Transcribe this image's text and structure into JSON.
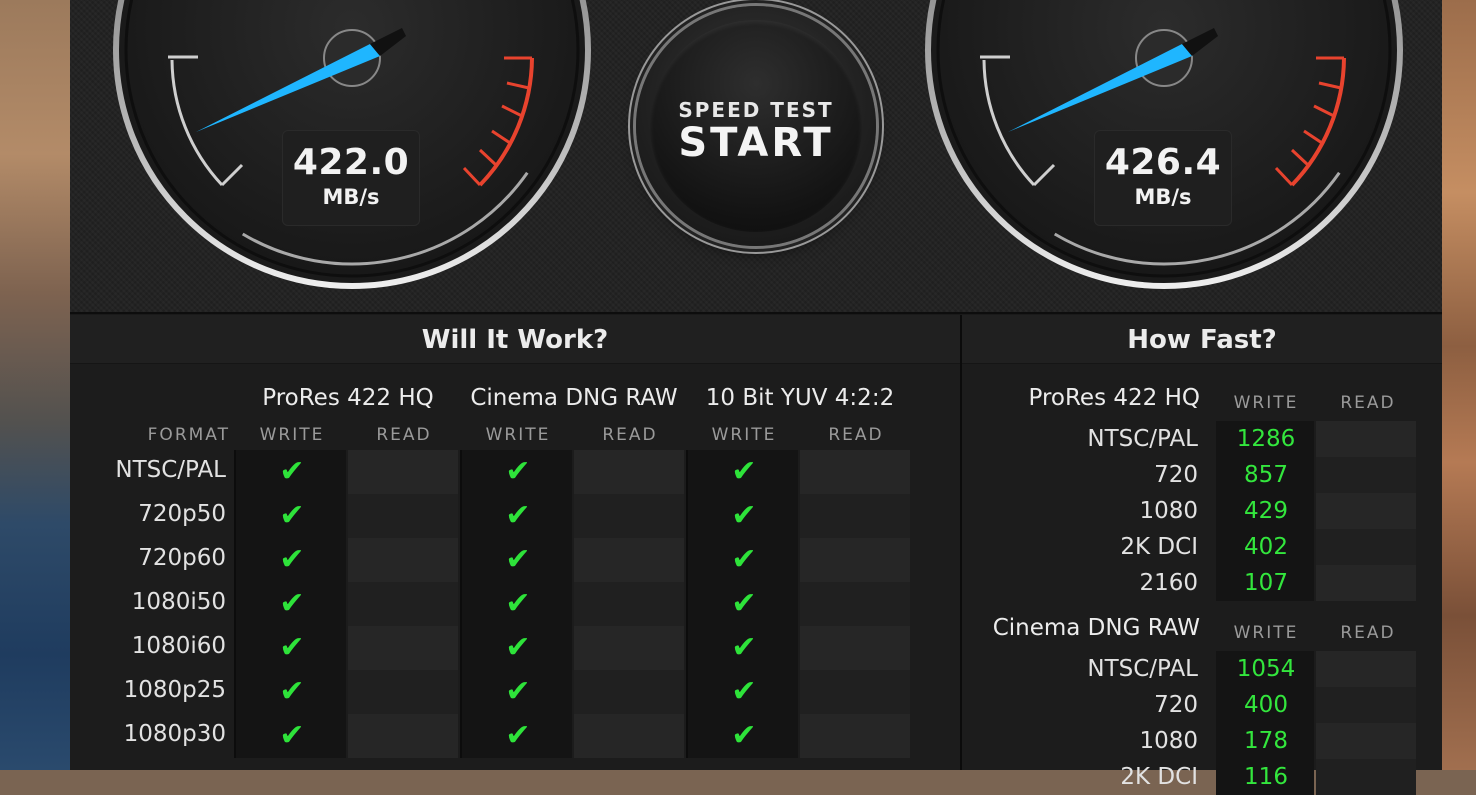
{
  "gauges": {
    "write": {
      "value": "422.0",
      "unit": "MB/s"
    },
    "read": {
      "value": "426.4",
      "unit": "MB/s"
    }
  },
  "start_button": {
    "small": "SPEED TEST",
    "big": "START"
  },
  "will_it_work": {
    "title": "Will It Work?",
    "format_label": "FORMAT",
    "write_label": "WRITE",
    "read_label": "READ",
    "codecs": [
      "ProRes 422 HQ",
      "Cinema DNG RAW",
      "10 Bit YUV 4:2:2"
    ],
    "rows": [
      "NTSC/PAL",
      "720p50",
      "720p60",
      "1080i50",
      "1080i60",
      "1080p25",
      "1080p30"
    ],
    "check_glyph": "✔"
  },
  "how_fast": {
    "title": "How Fast?",
    "write_label": "WRITE",
    "read_label": "READ",
    "sections": [
      {
        "name": "ProRes 422 HQ",
        "rows": [
          {
            "label": "NTSC/PAL",
            "write": "1286"
          },
          {
            "label": "720",
            "write": "857"
          },
          {
            "label": "1080",
            "write": "429"
          },
          {
            "label": "2K DCI",
            "write": "402"
          },
          {
            "label": "2160",
            "write": "107"
          }
        ]
      },
      {
        "name": "Cinema DNG RAW",
        "rows": [
          {
            "label": "NTSC/PAL",
            "write": "1054"
          },
          {
            "label": "720",
            "write": "400"
          },
          {
            "label": "1080",
            "write": "178"
          },
          {
            "label": "2K DCI",
            "write": "116"
          }
        ]
      }
    ]
  },
  "colors": {
    "accent_needle": "#1fb6ff",
    "check_green": "#2ee33a",
    "redline": "#e8432e"
  }
}
